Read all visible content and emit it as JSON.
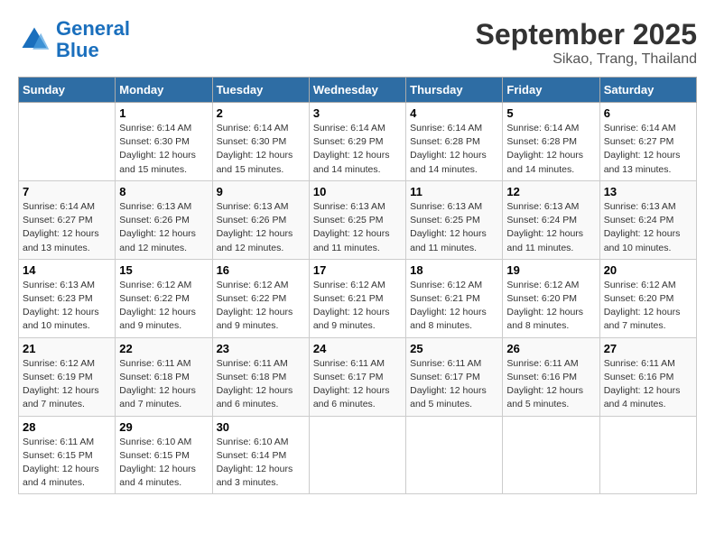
{
  "header": {
    "logo_line1": "General",
    "logo_line2": "Blue",
    "month_year": "September 2025",
    "location": "Sikao, Trang, Thailand"
  },
  "days_of_week": [
    "Sunday",
    "Monday",
    "Tuesday",
    "Wednesday",
    "Thursday",
    "Friday",
    "Saturday"
  ],
  "weeks": [
    [
      {
        "day": "",
        "info": ""
      },
      {
        "day": "1",
        "info": "Sunrise: 6:14 AM\nSunset: 6:30 PM\nDaylight: 12 hours\nand 15 minutes."
      },
      {
        "day": "2",
        "info": "Sunrise: 6:14 AM\nSunset: 6:30 PM\nDaylight: 12 hours\nand 15 minutes."
      },
      {
        "day": "3",
        "info": "Sunrise: 6:14 AM\nSunset: 6:29 PM\nDaylight: 12 hours\nand 14 minutes."
      },
      {
        "day": "4",
        "info": "Sunrise: 6:14 AM\nSunset: 6:28 PM\nDaylight: 12 hours\nand 14 minutes."
      },
      {
        "day": "5",
        "info": "Sunrise: 6:14 AM\nSunset: 6:28 PM\nDaylight: 12 hours\nand 14 minutes."
      },
      {
        "day": "6",
        "info": "Sunrise: 6:14 AM\nSunset: 6:27 PM\nDaylight: 12 hours\nand 13 minutes."
      }
    ],
    [
      {
        "day": "7",
        "info": "Sunrise: 6:14 AM\nSunset: 6:27 PM\nDaylight: 12 hours\nand 13 minutes."
      },
      {
        "day": "8",
        "info": "Sunrise: 6:13 AM\nSunset: 6:26 PM\nDaylight: 12 hours\nand 12 minutes."
      },
      {
        "day": "9",
        "info": "Sunrise: 6:13 AM\nSunset: 6:26 PM\nDaylight: 12 hours\nand 12 minutes."
      },
      {
        "day": "10",
        "info": "Sunrise: 6:13 AM\nSunset: 6:25 PM\nDaylight: 12 hours\nand 11 minutes."
      },
      {
        "day": "11",
        "info": "Sunrise: 6:13 AM\nSunset: 6:25 PM\nDaylight: 12 hours\nand 11 minutes."
      },
      {
        "day": "12",
        "info": "Sunrise: 6:13 AM\nSunset: 6:24 PM\nDaylight: 12 hours\nand 11 minutes."
      },
      {
        "day": "13",
        "info": "Sunrise: 6:13 AM\nSunset: 6:24 PM\nDaylight: 12 hours\nand 10 minutes."
      }
    ],
    [
      {
        "day": "14",
        "info": "Sunrise: 6:13 AM\nSunset: 6:23 PM\nDaylight: 12 hours\nand 10 minutes."
      },
      {
        "day": "15",
        "info": "Sunrise: 6:12 AM\nSunset: 6:22 PM\nDaylight: 12 hours\nand 9 minutes."
      },
      {
        "day": "16",
        "info": "Sunrise: 6:12 AM\nSunset: 6:22 PM\nDaylight: 12 hours\nand 9 minutes."
      },
      {
        "day": "17",
        "info": "Sunrise: 6:12 AM\nSunset: 6:21 PM\nDaylight: 12 hours\nand 9 minutes."
      },
      {
        "day": "18",
        "info": "Sunrise: 6:12 AM\nSunset: 6:21 PM\nDaylight: 12 hours\nand 8 minutes."
      },
      {
        "day": "19",
        "info": "Sunrise: 6:12 AM\nSunset: 6:20 PM\nDaylight: 12 hours\nand 8 minutes."
      },
      {
        "day": "20",
        "info": "Sunrise: 6:12 AM\nSunset: 6:20 PM\nDaylight: 12 hours\nand 7 minutes."
      }
    ],
    [
      {
        "day": "21",
        "info": "Sunrise: 6:12 AM\nSunset: 6:19 PM\nDaylight: 12 hours\nand 7 minutes."
      },
      {
        "day": "22",
        "info": "Sunrise: 6:11 AM\nSunset: 6:18 PM\nDaylight: 12 hours\nand 7 minutes."
      },
      {
        "day": "23",
        "info": "Sunrise: 6:11 AM\nSunset: 6:18 PM\nDaylight: 12 hours\nand 6 minutes."
      },
      {
        "day": "24",
        "info": "Sunrise: 6:11 AM\nSunset: 6:17 PM\nDaylight: 12 hours\nand 6 minutes."
      },
      {
        "day": "25",
        "info": "Sunrise: 6:11 AM\nSunset: 6:17 PM\nDaylight: 12 hours\nand 5 minutes."
      },
      {
        "day": "26",
        "info": "Sunrise: 6:11 AM\nSunset: 6:16 PM\nDaylight: 12 hours\nand 5 minutes."
      },
      {
        "day": "27",
        "info": "Sunrise: 6:11 AM\nSunset: 6:16 PM\nDaylight: 12 hours\nand 4 minutes."
      }
    ],
    [
      {
        "day": "28",
        "info": "Sunrise: 6:11 AM\nSunset: 6:15 PM\nDaylight: 12 hours\nand 4 minutes."
      },
      {
        "day": "29",
        "info": "Sunrise: 6:10 AM\nSunset: 6:15 PM\nDaylight: 12 hours\nand 4 minutes."
      },
      {
        "day": "30",
        "info": "Sunrise: 6:10 AM\nSunset: 6:14 PM\nDaylight: 12 hours\nand 3 minutes."
      },
      {
        "day": "",
        "info": ""
      },
      {
        "day": "",
        "info": ""
      },
      {
        "day": "",
        "info": ""
      },
      {
        "day": "",
        "info": ""
      }
    ]
  ]
}
